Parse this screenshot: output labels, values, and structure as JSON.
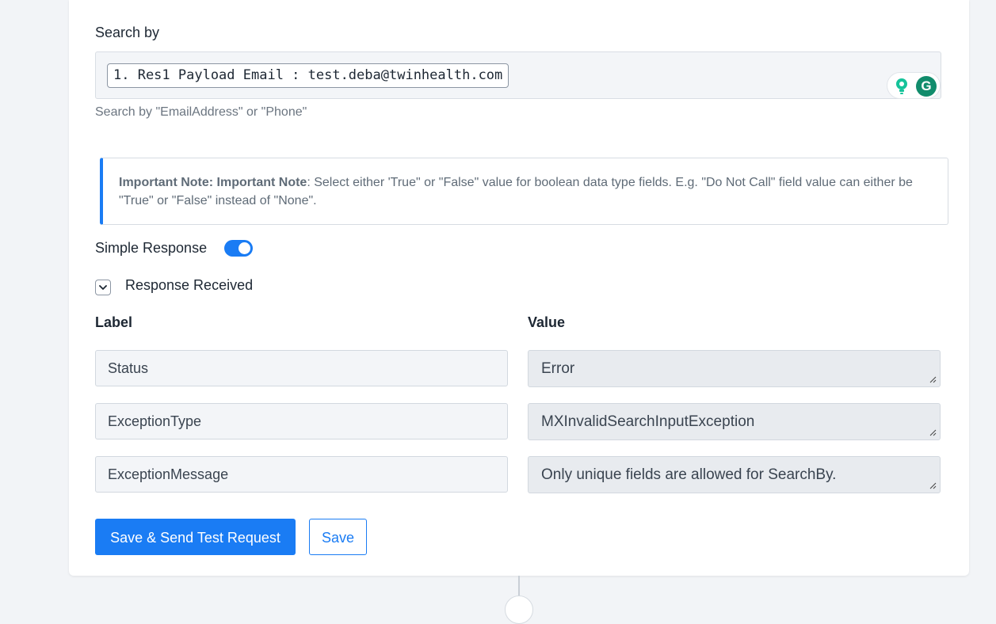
{
  "search": {
    "label": "Search by",
    "pill_value": "1. Res1 Payload Email : test.deba@twinhealth.com",
    "hint": "Search by \"EmailAddress\" or \"Phone\""
  },
  "grammarly": {
    "logo_letter": "G",
    "brand_color": "#118c6c"
  },
  "note": {
    "bold_prefix": "Important Note: Important Note",
    "text": ": Select either 'True\" or \"False\" value for boolean data type fields. E.g. \"Do Not Call\" field value can either be \"True\" or \"False\" instead of \"None\"."
  },
  "simple_response": {
    "label": "Simple Response",
    "enabled": true
  },
  "response": {
    "toggle_label": "Response Received",
    "label_header": "Label",
    "value_header": "Value",
    "rows": [
      {
        "label": "Status",
        "value": "Error"
      },
      {
        "label": "ExceptionType",
        "value": "MXInvalidSearchInputException"
      },
      {
        "label": "ExceptionMessage",
        "value": "Only unique fields are allowed for SearchBy."
      }
    ]
  },
  "actions": {
    "save_send_label": "Save & Send Test Request",
    "save_label": "Save"
  },
  "colors": {
    "accent": "#1a7cf4",
    "page_bg": "#f2f4f7"
  }
}
